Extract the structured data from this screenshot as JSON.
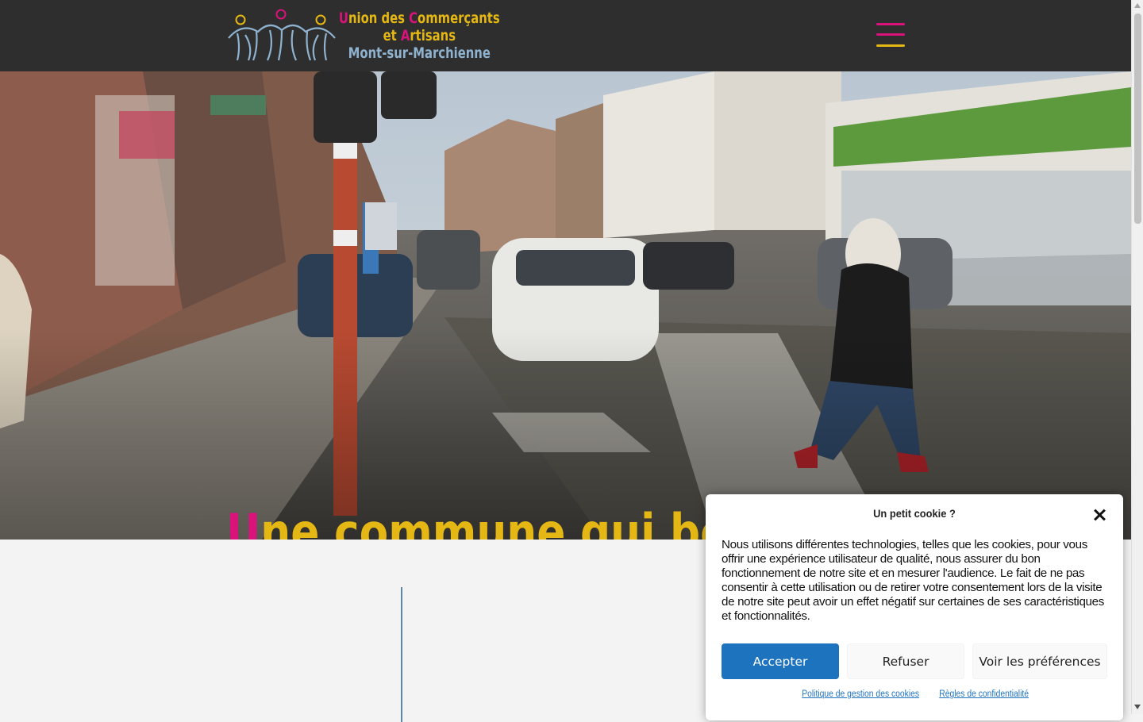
{
  "header": {
    "logo": {
      "line1": [
        "U",
        "nion des ",
        "C",
        "ommerçants"
      ],
      "line2": [
        "et ",
        "A",
        "rtisans"
      ],
      "line3": "Mont-sur-Marchienne"
    },
    "menu_icon": "hamburger-menu-icon"
  },
  "hero": {
    "title_first": "U",
    "title_rest": "ne commune qui bouge",
    "slides": 3,
    "active_slide": 2
  },
  "cookie_banner": {
    "title": "Un petit cookie ?",
    "body": "Nous utilisons différentes technologies, telles que les cookies, pour vous offrir une expérience utilisateur de qualité, nous assurer du bon fonctionnement de notre site et en mesurer l'audience. Le fait de ne pas consentir à cette utilisation ou de retirer votre consentement lors de la visite de notre site peut avoir un effet négatif sur certaines de ses caractéristiques et fonctionnalités.",
    "accept_label": "Accepter",
    "refuse_label": "Refuser",
    "preferences_label": "Voir les préférences",
    "link_cookie_policy": "Politique de gestion des cookies",
    "link_privacy": "Règles de confidentialité"
  },
  "colors": {
    "header_bg": "#2e2e2e",
    "brand_yellow": "#e4b715",
    "brand_pink": "#d9137a",
    "brand_blue": "#8fb2cf",
    "accept_blue": "#1e73be"
  }
}
